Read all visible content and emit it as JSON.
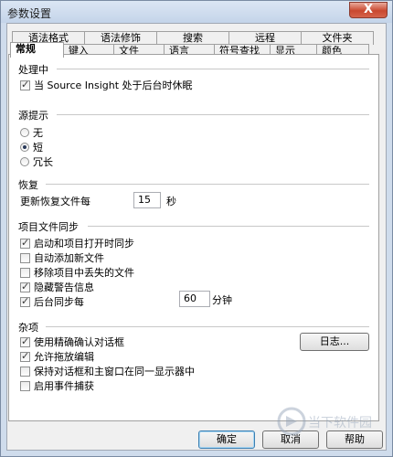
{
  "window": {
    "title": "参数设置",
    "close_glyph": "X"
  },
  "tabs": {
    "top_row": [
      "语法格式",
      "语法修饰",
      "搜索",
      "远程",
      "文件夹"
    ],
    "bottom_row": [
      "常规",
      "键入",
      "文件",
      "语言",
      "符号查找",
      "显示",
      "颜色"
    ],
    "active": "常规"
  },
  "groups": {
    "background": {
      "title": "处理中",
      "sleep_label": "当 Source Insight 处于后台时休眠",
      "sleep_checked": true
    },
    "source_hint": {
      "title": "源提示",
      "options": [
        "无",
        "短",
        "冗长"
      ],
      "selected": "短"
    },
    "recovery": {
      "title": "恢复",
      "label": "更新恢复文件每",
      "value": "15",
      "unit": "秒"
    },
    "project_sync": {
      "title": "项目文件同步",
      "items": [
        {
          "label": "启动和项目打开时同步",
          "checked": true
        },
        {
          "label": "自动添加新文件",
          "checked": false
        },
        {
          "label": "移除项目中丢失的文件",
          "checked": false
        },
        {
          "label": "隐藏警告信息",
          "checked": true
        },
        {
          "label": "后台同步每",
          "checked": true
        }
      ],
      "interval_value": "60",
      "interval_unit": "分钟"
    },
    "misc": {
      "title": "杂项",
      "items": [
        {
          "label": "使用精确确认对话框",
          "checked": true
        },
        {
          "label": "允许拖放编辑",
          "checked": true
        },
        {
          "label": "保持对话框和主窗口在同一显示器中",
          "checked": false
        },
        {
          "label": "启用事件捕获",
          "checked": false
        }
      ],
      "log_button": "日志..."
    }
  },
  "buttons": {
    "ok": "确定",
    "cancel": "取消",
    "help": "帮助"
  },
  "watermark": {
    "text": "当下软件园"
  }
}
